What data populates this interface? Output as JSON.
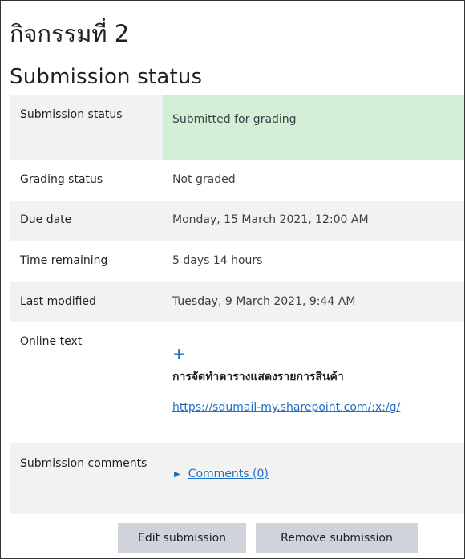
{
  "page": {
    "title": "กิจกรรมที่ 2",
    "section_title": "Submission status"
  },
  "rows": {
    "submission_status": {
      "label": "Submission status",
      "value": "Submitted for grading"
    },
    "grading_status": {
      "label": "Grading status",
      "value": "Not graded"
    },
    "due_date": {
      "label": "Due date",
      "value": "Monday, 15 March 2021, 12:00 AM"
    },
    "time_remaining": {
      "label": "Time remaining",
      "value": "5 days 14 hours"
    },
    "last_modified": {
      "label": "Last modified",
      "value": "Tuesday, 9 March 2021, 9:44 AM"
    },
    "online_text": {
      "label": "Online text",
      "icon": "plus-icon",
      "title": "การจัดทำตารางแสดงรายการสินค้า",
      "link": "https://sdumail-my.sharepoint.com/:x:/g/"
    },
    "submission_comments": {
      "label": "Submission comments",
      "link": "Comments (0)",
      "icon": "caret-right-icon"
    }
  },
  "buttons": {
    "edit": "Edit submission",
    "remove": "Remove submission"
  },
  "colors": {
    "submitted_bg": "#d3f0d6",
    "link": "#1f6fc5",
    "button_bg": "#ced4da",
    "row_alt_bg": "#f2f2f2"
  }
}
